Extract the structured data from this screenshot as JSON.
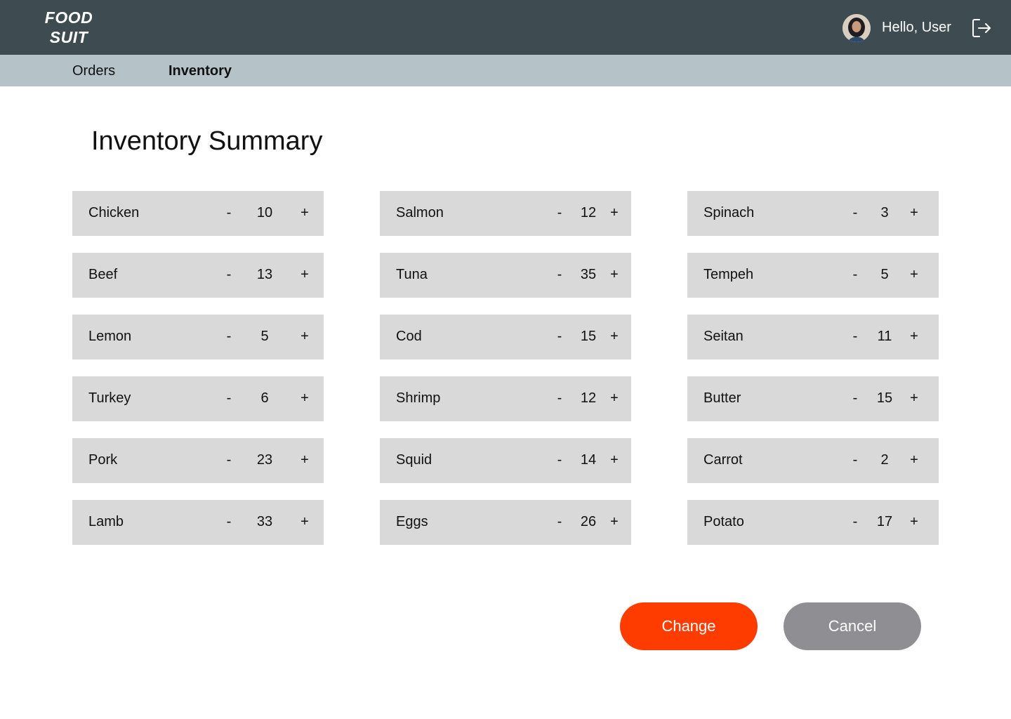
{
  "header": {
    "logo_line1": "FOOD",
    "logo_line2": "SUIT",
    "greeting": "Hello, User",
    "avatar_icon": "user-avatar",
    "logout_icon": "logout-icon"
  },
  "nav": {
    "tabs": [
      {
        "label": "Orders",
        "active": false
      },
      {
        "label": "Inventory",
        "active": true
      }
    ]
  },
  "main": {
    "title": "Inventory Summary",
    "columns": [
      [
        {
          "name": "Chicken",
          "qty": "10"
        },
        {
          "name": "Beef",
          "qty": "13"
        },
        {
          "name": "Lemon",
          "qty": "5"
        },
        {
          "name": "Turkey",
          "qty": "6"
        },
        {
          "name": "Pork",
          "qty": "23"
        },
        {
          "name": "Lamb",
          "qty": "33"
        }
      ],
      [
        {
          "name": "Salmon",
          "qty": "12"
        },
        {
          "name": "Tuna",
          "qty": "35"
        },
        {
          "name": "Cod",
          "qty": "15"
        },
        {
          "name": "Shrimp",
          "qty": "12"
        },
        {
          "name": "Squid",
          "qty": "14"
        },
        {
          "name": "Eggs",
          "qty": "26"
        }
      ],
      [
        {
          "name": "Spinach",
          "qty": "3"
        },
        {
          "name": "Tempeh",
          "qty": "5"
        },
        {
          "name": "Seitan",
          "qty": "11"
        },
        {
          "name": "Butter",
          "qty": "15"
        },
        {
          "name": "Carrot",
          "qty": "2"
        },
        {
          "name": "Potato",
          "qty": "17"
        }
      ]
    ],
    "decrement_label": "-",
    "increment_label": "+"
  },
  "actions": {
    "change_label": "Change",
    "cancel_label": "Cancel"
  },
  "colors": {
    "header_bg": "#3e4c52",
    "nav_bg": "#b5c2c7",
    "card_bg": "#d9d9d9",
    "primary": "#ff3c00",
    "secondary": "#8e8e93"
  }
}
